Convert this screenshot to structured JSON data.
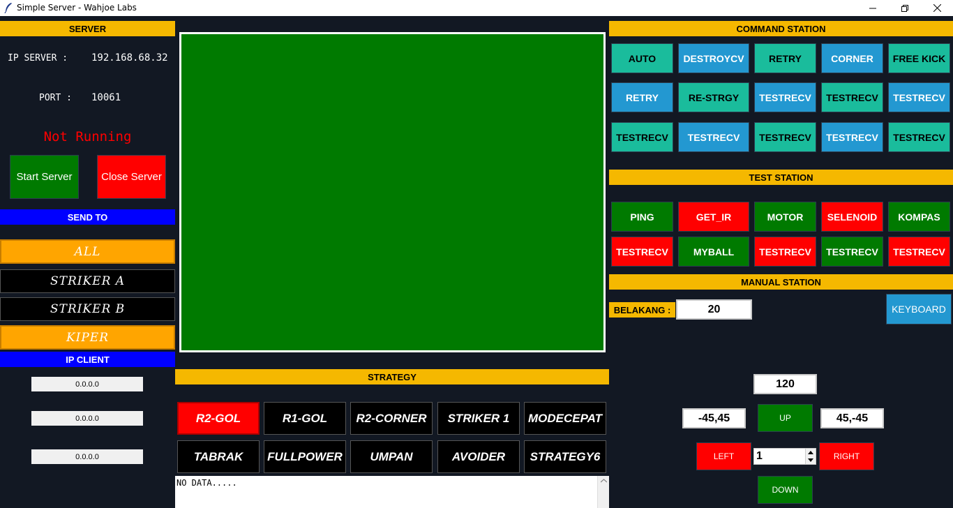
{
  "window": {
    "title": "Simple Server - Wahjoe Labs"
  },
  "server": {
    "header": "SERVER",
    "ip_label": "IP SERVER :",
    "ip_value": "192.168.68.32",
    "port_label": "PORT :",
    "port_value": "10061",
    "status": "Not Running",
    "start_label": "Start Server",
    "close_label": "Close Server"
  },
  "send_to": {
    "header": "SEND TO",
    "targets": [
      "ALL",
      "STRIKER A",
      "STRIKER B",
      "KIPER"
    ]
  },
  "ip_client": {
    "header": "IP CLIENT",
    "values": [
      "0.0.0.0",
      "0.0.0.0",
      "0.0.0.0"
    ]
  },
  "strategy": {
    "header": "STRATEGY",
    "buttons": [
      "R2-GOL",
      "R1-GOL",
      "R2-CORNER",
      "STRIKER 1",
      "MODECEPAT",
      "TABRAK",
      "FULLPOWER",
      "UMPAN",
      "AVOIDER",
      "STRATEGY6"
    ]
  },
  "log": {
    "text": "NO DATA....."
  },
  "command_station": {
    "header": "COMMAND STATION",
    "buttons": [
      "AUTO",
      "DESTROYCV",
      "RETRY",
      "CORNER",
      "FREE KICK",
      "RETRY",
      "RE-STRGY",
      "TESTRECV",
      "TESTRECV",
      "TESTRECV",
      "TESTRECV",
      "TESTRECV",
      "TESTRECV",
      "TESTRECV",
      "TESTRECV"
    ]
  },
  "test_station": {
    "header": "TEST STATION",
    "buttons": [
      "PING",
      "GET_IR",
      "MOTOR",
      "SELENOID",
      "KOMPAS",
      "TESTRECV",
      "MYBALL",
      "TESTRECV",
      "TESTRECV",
      "TESTRECV"
    ]
  },
  "manual_station": {
    "header": "MANUAL STATION",
    "belakang_label": "BELAKANG :",
    "belakang_value": "20",
    "keyboard_label": "KEYBOARD",
    "speed_value": "120",
    "left_coord": "-45,45",
    "right_coord": "45,-45",
    "up_label": "UP",
    "down_label": "DOWN",
    "left_label": "LEFT",
    "right_label": "RIGHT",
    "spin_value": "1"
  },
  "colors": {
    "background": "#121823",
    "header_yellow": "#f5b800",
    "header_blue": "#0000ff",
    "canvas_green": "#007a00",
    "teal": "#1abc9c",
    "blue": "#2398d1",
    "green": "#007a00",
    "red": "#ff0000",
    "orange": "#ffa500",
    "status_red": "#ff0000"
  }
}
